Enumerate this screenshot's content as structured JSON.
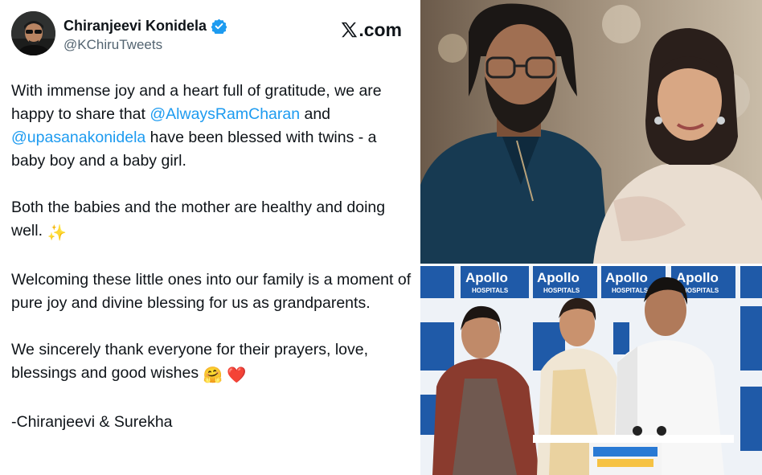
{
  "tweet": {
    "display_name": "Chiranjeevi Konidela",
    "handle": "@KChiruTweets",
    "site_brand": ".com",
    "paragraph1": {
      "part1": "With immense joy and a heart full of gratitude, we are happy to share that ",
      "mention1": "@AlwaysRamCharan",
      "part2": " and ",
      "mention2": "@upasanakonidela",
      "part3": " have been blessed with twins - a baby boy and a baby girl."
    },
    "paragraph2": {
      "text": "Both the babies and the mother are healthy and doing well. ",
      "emoji": "✨"
    },
    "paragraph3": "Welcoming these little ones into our family is a moment of pure joy and divine blessing for us as grandparents.",
    "paragraph4": {
      "text": "We sincerely thank everyone for their prayers, love, blessings and good wishes ",
      "emoji1": "🤗",
      "emoji2": "❤️"
    },
    "signature": "-Chiranjeevi & Surekha"
  },
  "photos": {
    "hospital_logo": "Apollo",
    "hospital_sub": "HOSPITALS"
  },
  "colors": {
    "text": "#0f1419",
    "secondary_text": "#536471",
    "link": "#1d9bf0",
    "verified": "#1d9bf0",
    "backdrop_blue": "#1f5aa8"
  }
}
